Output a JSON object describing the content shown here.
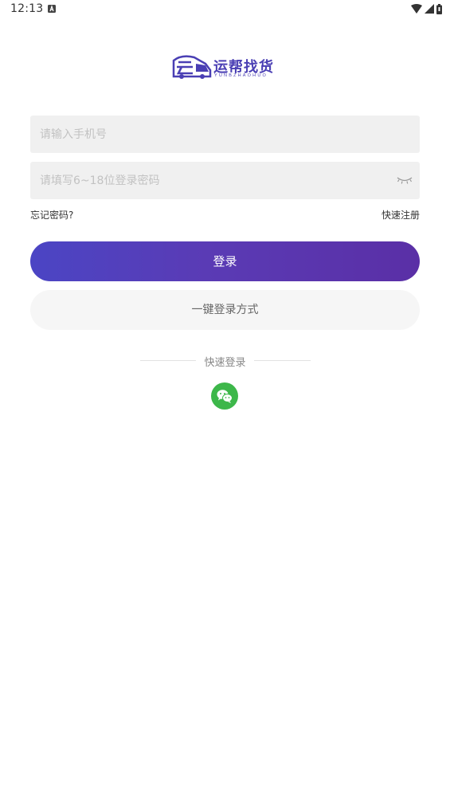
{
  "status_bar": {
    "time": "12:13",
    "notification_icon": "a-icon",
    "icons": [
      "wifi-icon",
      "signal-icon",
      "battery-icon"
    ]
  },
  "logo": {
    "title": "运帮找货",
    "subtitle": "YUNBZHAOHUO",
    "icon": "truck-logo-icon",
    "brand_color": "#4a3fb4"
  },
  "login_form": {
    "phone_placeholder": "请输入手机号",
    "password_placeholder": "请填写6~18位登录密码",
    "password_toggle_icon": "eye-closed-icon",
    "forgot_password": "忘记密码?",
    "quick_register": "快速注册",
    "login_button": "登录",
    "onekey_login_button": "一键登录方式"
  },
  "quick_login": {
    "label": "快速登录",
    "wechat_icon": "wechat-icon",
    "wechat_color": "#3db74a"
  },
  "colors": {
    "primary_gradient_start": "#4b45c4",
    "primary_gradient_end": "#5a2fa6",
    "field_background": "#f0f0f0",
    "secondary_button_background": "#f6f6f6"
  }
}
